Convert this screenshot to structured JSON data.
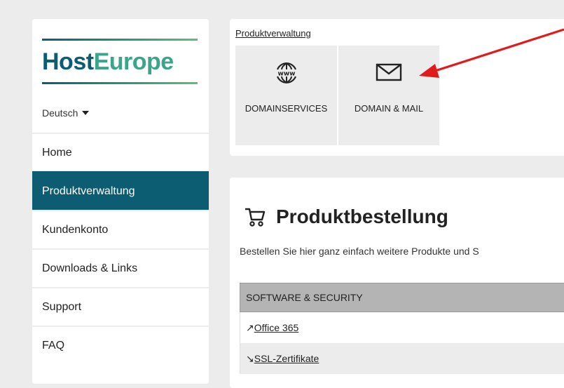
{
  "brand": {
    "host": "Host",
    "europe": "Europe"
  },
  "language": {
    "selected": "Deutsch"
  },
  "sidebar": {
    "items": [
      {
        "label": "Home",
        "active": false
      },
      {
        "label": "Produktverwaltung",
        "active": true
      },
      {
        "label": "Kundenkonto",
        "active": false
      },
      {
        "label": "Downloads & Links",
        "active": false
      },
      {
        "label": "Support",
        "active": false
      },
      {
        "label": "FAQ",
        "active": false
      }
    ]
  },
  "product_admin": {
    "title": "Produktverwaltung",
    "tiles": [
      {
        "label": "DOMAINSERVICES",
        "icon": "www-globe-icon"
      },
      {
        "label": "DOMAIN & MAIL",
        "icon": "envelope-icon"
      }
    ]
  },
  "order": {
    "title": "Produktbestellung",
    "description": "Bestellen Sie hier ganz einfach weitere Produkte und S",
    "table": {
      "header": "SOFTWARE & SECURITY",
      "rows": [
        {
          "prefix": "↗",
          "label": "Office 365"
        },
        {
          "prefix": "↘",
          "label": "SSL-Zertifikate"
        }
      ]
    }
  },
  "colors": {
    "accent": "#0d5d72",
    "annotation_arrow": "#e01b1b"
  }
}
